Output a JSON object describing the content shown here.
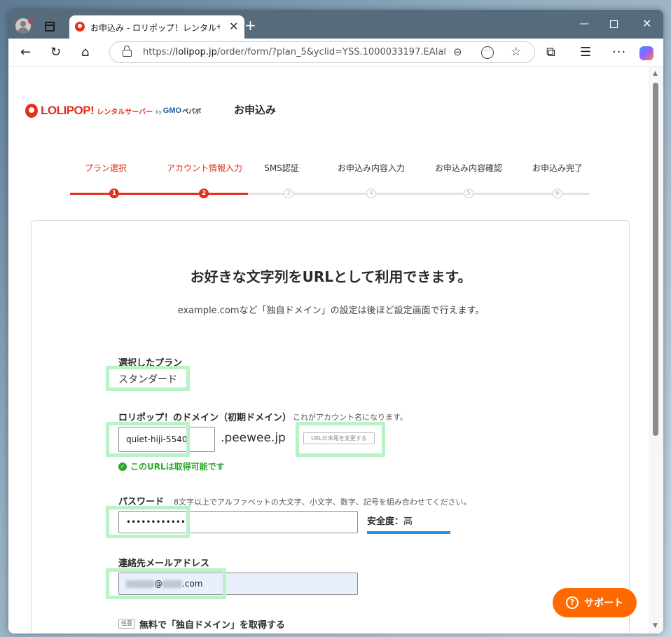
{
  "browser": {
    "tab_title": "お申込み - ロリポップ！レンタルサーバ",
    "tab_close": "✕",
    "new_tab": "+",
    "url_prefix": "https://",
    "url_host": "lolipop.jp",
    "url_rest": "/order/form/?plan_5&yclid=YSS.1000033197.EAIal...",
    "window_controls": {
      "minimize": "—",
      "close": "✕"
    }
  },
  "header": {
    "logo_main": "LOLIPOP!",
    "logo_sub": "レンタルサーバー",
    "logo_by": "by",
    "logo_gmo": "GMO",
    "logo_pepabo": "ペパボ",
    "title": "お申込み"
  },
  "steps": [
    {
      "label": "プラン選択",
      "num": "1",
      "active": true
    },
    {
      "label": "アカウント情報入力",
      "num": "2",
      "active": true
    },
    {
      "label": "SMS認証",
      "num": "3",
      "active": false
    },
    {
      "label": "お申込み内容入力",
      "num": "4",
      "active": false
    },
    {
      "label": "お申込み内容確認",
      "num": "5",
      "active": false
    },
    {
      "label": "お申込み完了",
      "num": "6",
      "active": false
    }
  ],
  "form": {
    "heading": "お好きな文字列をURLとして利用できます。",
    "subheading": "example.comなど「独自ドメイン」の設定は後ほど設定画面で行えます。",
    "plan": {
      "label": "選択したプラン",
      "value": "スタンダード"
    },
    "domain": {
      "label": "ロリポップ！のドメイン（初期ドメイン）",
      "note": "これがアカウント名になります。",
      "value": "quiet-hiji-5540",
      "suffix": ".peewee.jp",
      "change_button": "URLの末尾を変更する",
      "available_msg": "このURLは取得可能です"
    },
    "password": {
      "label": "パスワード",
      "note": "8文字以上でアルファベットの大文字、小文字、数字、記号を組み合わせてください。",
      "value": "••••••••••••",
      "strength_label": "安全度：",
      "strength_value": "高",
      "strength_color": "#2b8fe0"
    },
    "email": {
      "label": "連絡先メールアドレス",
      "value_at": "@",
      "value_tld": ".com"
    },
    "optional": {
      "badge": "任意",
      "label": "無料で「独自ドメイン」を取得する"
    }
  },
  "support_button": "サポート",
  "colors": {
    "brand": "#e2311e",
    "support": "#ff6a00",
    "highlight": "#b8f2c6",
    "ok": "#2aa82a"
  }
}
